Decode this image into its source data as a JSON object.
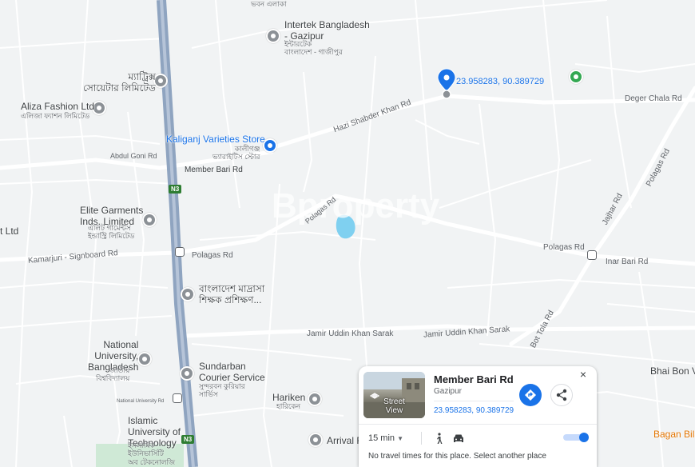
{
  "map": {
    "background_color": "#f1f3f4",
    "road_color": "#ffffff",
    "highway_color": "#8fa4c0",
    "water_color": "#7fd0f0"
  },
  "highway_shields": [
    "N3",
    "N3"
  ],
  "roads": {
    "hazi_shabder_khan": "Hazi Shabder Khan Rd",
    "deger_chala": "Deger Chala Rd",
    "abdul_goni": "Abdul Goni Rd",
    "member_bari": "Member Bari Rd",
    "polagas_diag": "Polagas Rd",
    "polagas_west": "Polagas Rd",
    "polagas_east": "Polagas Rd",
    "kamarjuri": "Kamarjuri - Signboard Rd",
    "inar_bari": "Inar Bari Rd",
    "jamir_uddin_1": "Jamir Uddin Khan Sarak",
    "jamir_uddin_2": "Jamir Uddin Khan Sarak",
    "jajhar": "Jajhar Rd",
    "bot_tola": "Bot Tola Rd",
    "national_university": "National University Rd"
  },
  "pois": {
    "intertek_name": "Intertek Bangladesh\n- Gazipur",
    "intertek_sub": "ইন্টারটেক\nবাংলাদেশ - গাজীপুর",
    "top_partial_sub": "ভবন এলাকা",
    "matrix_name": "ম্যাট্রিক্স\nসোয়েটার লিমিটেড",
    "aliza_name": "Aliza Fashion Ltd",
    "aliza_sub": "এলিজা ফ্যাশন লিমিটেড",
    "kaliganj_name": "Kaliganj Varieties Store",
    "kaliganj_sub": "কালীগঞ্জ\nভ্যারাইটিস স্টোর",
    "elite_name": "Elite Garments\nInds. Limited",
    "elite_sub": "এলিট গার্মেন্টস\nইন্ডাস্ট্রি লিমিটেড",
    "partial_ltd": "t Ltd",
    "madrasa_name": "বাংলাদেশ মাদ্রাসা\nশিক্ষক প্রশিক্ষণ...",
    "nu_name": "National\nUniversity,\nBangladesh",
    "nu_sub": "জাতীয়\nবিশ্ববিদ্যালয়",
    "sundarban_name": "Sundarban\nCourier Service",
    "sundarban_sub": "সুন্দরবন কুরিয়ার\nসার্ভিস",
    "hariken_name": "Hariken",
    "hariken_sub": "হারিকেন",
    "islamic_name": "Islamic\nUniversity of\nTechnology",
    "islamic_sub": "ইসলামিক\nইউনিভার্সিটি\nঅব টেকনোলজি",
    "arrival_name": "Arrival F",
    "bhai_bon": "Bhai Bon V",
    "bagan_bila": "Bagan Bila",
    "watermark": "Bproperty"
  },
  "dropped_pin": {
    "coords": "23.958283, 90.389729",
    "pin_color": "#1a73e8"
  },
  "place_card": {
    "thumb_label": "Street\nView",
    "title": "Member Bari Rd",
    "subtitle": "Gazipur",
    "coords": "23.958283, 90.389729",
    "directions_icon": "directions-icon",
    "share_icon": "share-icon",
    "close_icon": "close-icon",
    "time_select": "15 min",
    "walk_icon": "walk-icon",
    "car_icon": "car-icon",
    "no_times": "No travel times for this place. Select another place",
    "accent_color": "#1a73e8"
  }
}
